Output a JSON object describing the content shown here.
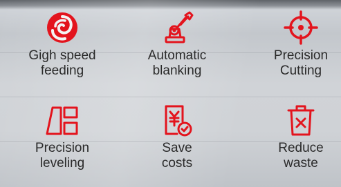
{
  "accent_color": "#e3141d",
  "features": [
    {
      "icon": "swirl-icon",
      "label": "Gigh speed\nfeeding"
    },
    {
      "icon": "robot-arm-icon",
      "label": "Automatic\nblanking"
    },
    {
      "icon": "crosshair-icon",
      "label": "Precision\nCutting"
    },
    {
      "icon": "leveling-icon",
      "label": "Precision\nleveling"
    },
    {
      "icon": "yen-document-check-icon",
      "label": "Save\ncosts"
    },
    {
      "icon": "trash-x-icon",
      "label": "Reduce\nwaste"
    }
  ]
}
